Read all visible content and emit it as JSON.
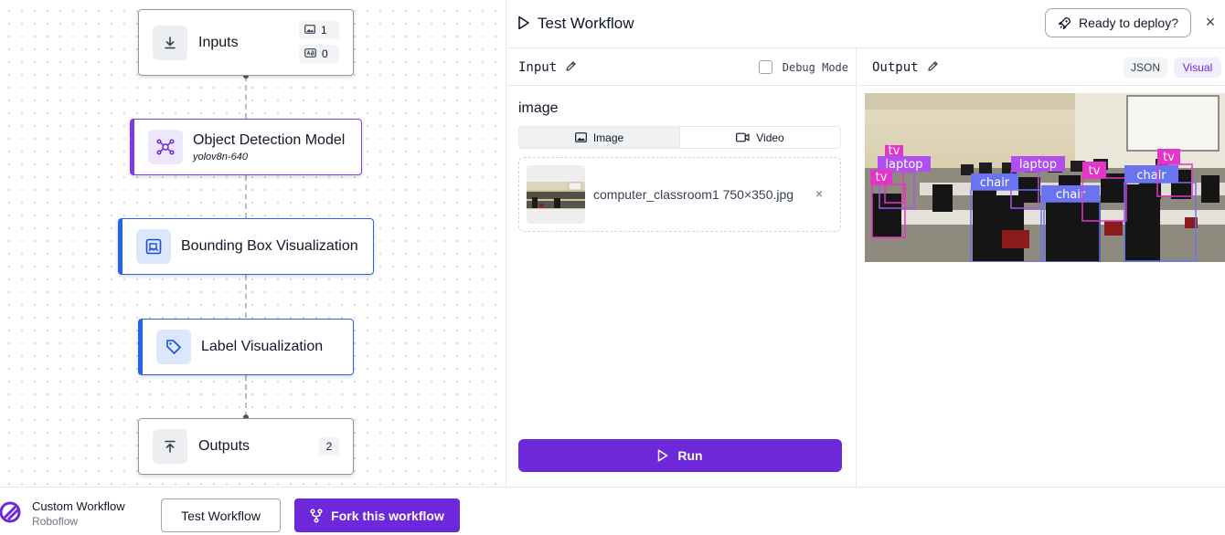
{
  "canvas": {
    "nodes": {
      "inputs": {
        "title": "Inputs",
        "badge_image_count": "1",
        "badge_param_count": "0"
      },
      "detection": {
        "title": "Object Detection Model",
        "subtitle": "yolov8n-640"
      },
      "bbox": {
        "title": "Bounding Box Visualization"
      },
      "label": {
        "title": "Label Visualization"
      },
      "outputs": {
        "title": "Outputs",
        "count": "2"
      }
    }
  },
  "panel": {
    "title": "Test Workflow",
    "deploy_label": "Ready to deploy?",
    "close_glyph": "×",
    "input": {
      "header": "Input",
      "debug_label": "Debug Mode",
      "field_label": "image",
      "tabs": [
        "Image",
        "Video"
      ],
      "file_name": "computer_classroom1 750×350.jpg",
      "remove_glyph": "×",
      "run_label": "Run"
    },
    "output": {
      "header": "Output",
      "json_label": "JSON",
      "visual_label": "Visual",
      "detections": [
        {
          "label": "tv",
          "color": "#e535c8"
        },
        {
          "label": "laptop",
          "color": "#b04ef0"
        },
        {
          "label": "tv",
          "color": "#e535c8"
        },
        {
          "label": "laptop",
          "color": "#b04ef0"
        },
        {
          "label": "chair",
          "color": "#6b74f0"
        },
        {
          "label": "chair",
          "color": "#6b74f0"
        },
        {
          "label": "tv",
          "color": "#e535c8"
        },
        {
          "label": "chair",
          "color": "#6b74f0"
        },
        {
          "label": "tv",
          "color": "#e535c8"
        }
      ]
    }
  },
  "footer": {
    "app_name": "Custom Workflow",
    "org_name": "Roboflow",
    "test_label": "Test Workflow",
    "fork_label": "Fork this workflow"
  },
  "colors": {
    "accent": "#6d28d9",
    "node_purple": "#7c3aed",
    "node_blue": "#2563eb"
  }
}
